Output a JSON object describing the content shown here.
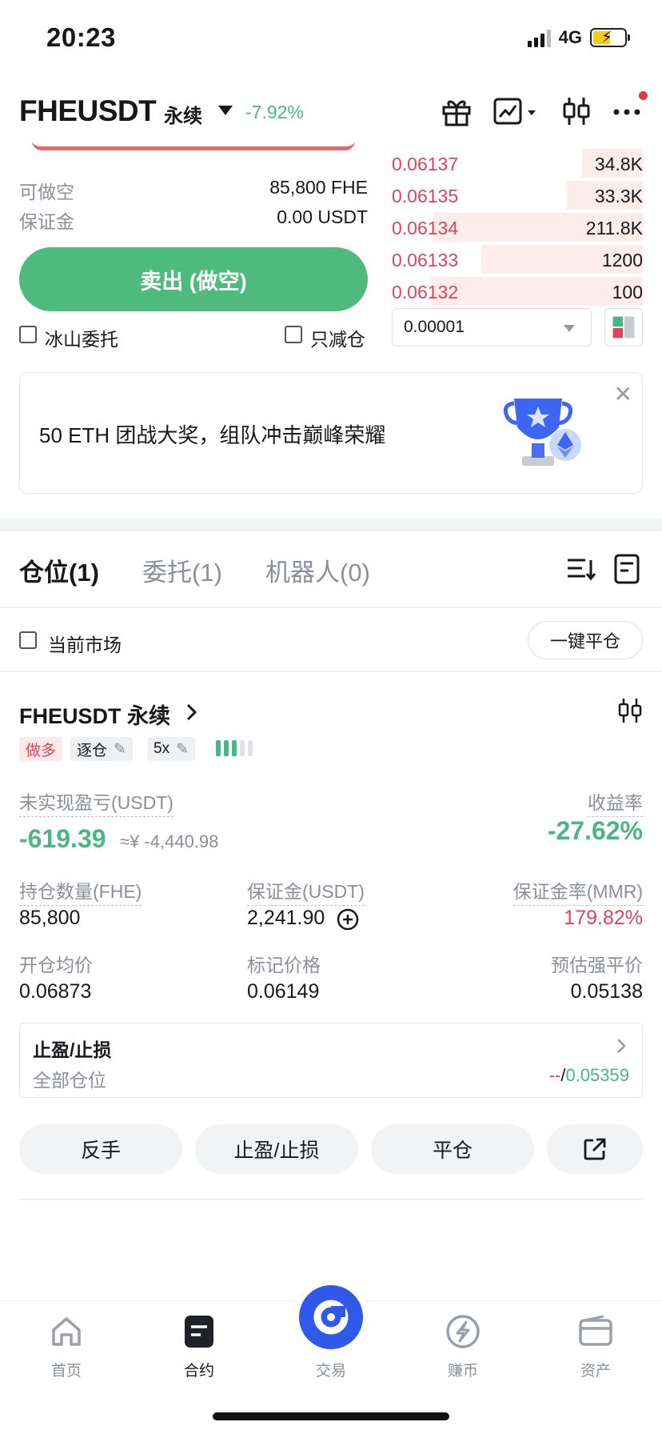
{
  "status_bar": {
    "time": "20:23",
    "network": "4G"
  },
  "header": {
    "pair": "FHEUSDT",
    "contract_type": "永续",
    "change": "-7.92%"
  },
  "order_form": {
    "available_short_label": "可做空",
    "available_short_value": "85,800 FHE",
    "margin_label": "保证金",
    "margin_value": "0.00 USDT",
    "sell_button": "卖出 (做空)",
    "iceberg_label": "冰山委托",
    "reduce_only_label": "只减仓"
  },
  "order_book": {
    "asks": [
      {
        "price": "0.06137",
        "qty": "34.8K",
        "depth": 0.24
      },
      {
        "price": "0.06135",
        "qty": "33.3K",
        "depth": 0.3
      },
      {
        "price": "0.06134",
        "qty": "211.8K",
        "depth": 0.83
      },
      {
        "price": "0.06133",
        "qty": "1200",
        "depth": 0.64
      },
      {
        "price": "0.06132",
        "qty": "100",
        "depth": 0.84
      }
    ],
    "tick_size": "0.00001"
  },
  "banner": {
    "text": "50 ETH 团战大奖，组队冲击巅峰荣耀",
    "close": "✕"
  },
  "tabs": [
    "仓位(1)",
    "委托(1)",
    "机器人(0)"
  ],
  "filter": {
    "current_market_label": "当前市场",
    "close_all_button": "一键平仓"
  },
  "position": {
    "symbol": "FHEUSDT 永续",
    "side": "做多",
    "margin_mode": "逐仓",
    "leverage": "5x",
    "unrealized_pnl_label": "未实现盈亏(USDT)",
    "unrealized_pnl": "-619.39",
    "unrealized_pnl_cny": "≈¥ -4,440.98",
    "roe_label": "收益率",
    "roe": "-27.62%",
    "size_label": "持仓数量(FHE)",
    "size": "85,800",
    "margin_label": "保证金(USDT)",
    "margin": "2,241.90",
    "mmr_label": "保证金率(MMR)",
    "mmr": "179.82%",
    "entry_label": "开仓均价",
    "entry": "0.06873",
    "mark_label": "标记价格",
    "mark": "0.06149",
    "liq_label": "预估强平价",
    "liq": "0.05138",
    "tpsl_title": "止盈/止损",
    "tpsl_scope": "全部仓位",
    "tpsl_tp": "--",
    "tpsl_sep": "/",
    "tpsl_sl": "0.05359"
  },
  "actions": {
    "reverse": "反手",
    "tpsl": "止盈/止损",
    "close": "平仓"
  },
  "bottom_nav": [
    {
      "label": "首页",
      "icon": "home-icon"
    },
    {
      "label": "合约",
      "icon": "contract-icon"
    },
    {
      "label": "交易",
      "icon": "trade-icon"
    },
    {
      "label": "赚币",
      "icon": "earn-icon"
    },
    {
      "label": "资产",
      "icon": "wallet-icon"
    }
  ],
  "colors": {
    "green": "#4cb584",
    "red": "#d9475b",
    "blue": "#2f59e8"
  }
}
